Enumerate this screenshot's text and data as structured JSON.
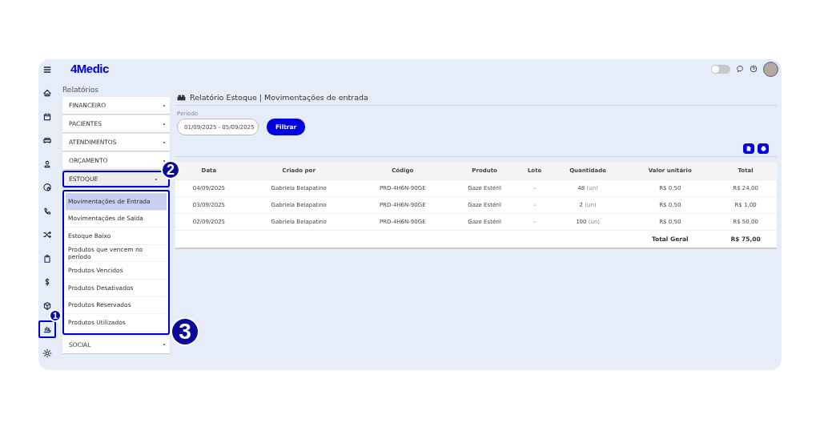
{
  "header": {
    "logo": "4Medic",
    "theme_toggle": {
      "on": false
    }
  },
  "sidebar": {
    "items": [
      {
        "kind": "home"
      },
      {
        "kind": "calendar"
      },
      {
        "kind": "sofa"
      },
      {
        "kind": "user"
      },
      {
        "kind": "at"
      },
      {
        "kind": "phone"
      },
      {
        "kind": "shuffle"
      },
      {
        "kind": "clipboard"
      },
      {
        "kind": "dollar"
      },
      {
        "kind": "cube"
      },
      {
        "kind": "hand",
        "callout": "1"
      },
      {
        "kind": "gear"
      }
    ]
  },
  "page_title": "Relatórios",
  "report_menu": [
    {
      "label": "FINANCEIRO",
      "expanded": false
    },
    {
      "label": "PACIENTES",
      "expanded": false
    },
    {
      "label": "ATENDIMENTOS",
      "expanded": false
    },
    {
      "label": "ORÇAMENTO",
      "expanded": false
    },
    {
      "label": "ESTOQUE",
      "expanded": true,
      "callout": "2",
      "children_callout": "3",
      "children": [
        {
          "label": "Movimentações de Entrada",
          "selected": true
        },
        {
          "label": "Movimentações de Saída",
          "selected": false
        },
        {
          "label": "Estoque Baixo",
          "selected": false
        },
        {
          "label": "Produtos que vencem no período",
          "selected": false
        },
        {
          "label": "Produtos Vencidos",
          "selected": false
        },
        {
          "label": "Produtos Desativados",
          "selected": false
        },
        {
          "label": "Produtos Reservados",
          "selected": false
        },
        {
          "label": "Produtos Utilizados",
          "selected": false
        }
      ]
    },
    {
      "label": "SOCIAL",
      "expanded": false
    }
  ],
  "report": {
    "title": "Relatório Estoque | Movimentações de entrada",
    "filter": {
      "label": "Período",
      "value": "01/09/2025 - 05/09/2025",
      "button": "Filtrar"
    },
    "table": {
      "columns": [
        "Data",
        "Criado por",
        "Código",
        "Produto",
        "Lote",
        "Quantidade",
        "Valor unitário",
        "Total"
      ],
      "rows": [
        [
          "04/09/2025",
          "Gabriela Belapatino",
          "PRD-4H6N-90GE",
          "Gaze Estéril",
          "-",
          {
            "amount": "48",
            "unit": "(un)"
          },
          "R$ 0,50",
          "R$ 24,00"
        ],
        [
          "03/09/2025",
          "Gabriela Belapatino",
          "PRD-4H6N-90GE",
          "Gaze Estéril",
          "-",
          {
            "amount": "2",
            "unit": "(un)"
          },
          "R$ 0,50",
          "R$ 1,00"
        ],
        [
          "02/09/2025",
          "Gabriela Belapatino",
          "PRD-4H6N-90GE",
          "Gaze Estéril",
          "-",
          {
            "amount": "100",
            "unit": "(un)"
          },
          "R$ 0,50",
          "R$ 50,00"
        ]
      ],
      "footer": {
        "label": "Total Geral",
        "value": "R$ 75,00"
      }
    }
  }
}
